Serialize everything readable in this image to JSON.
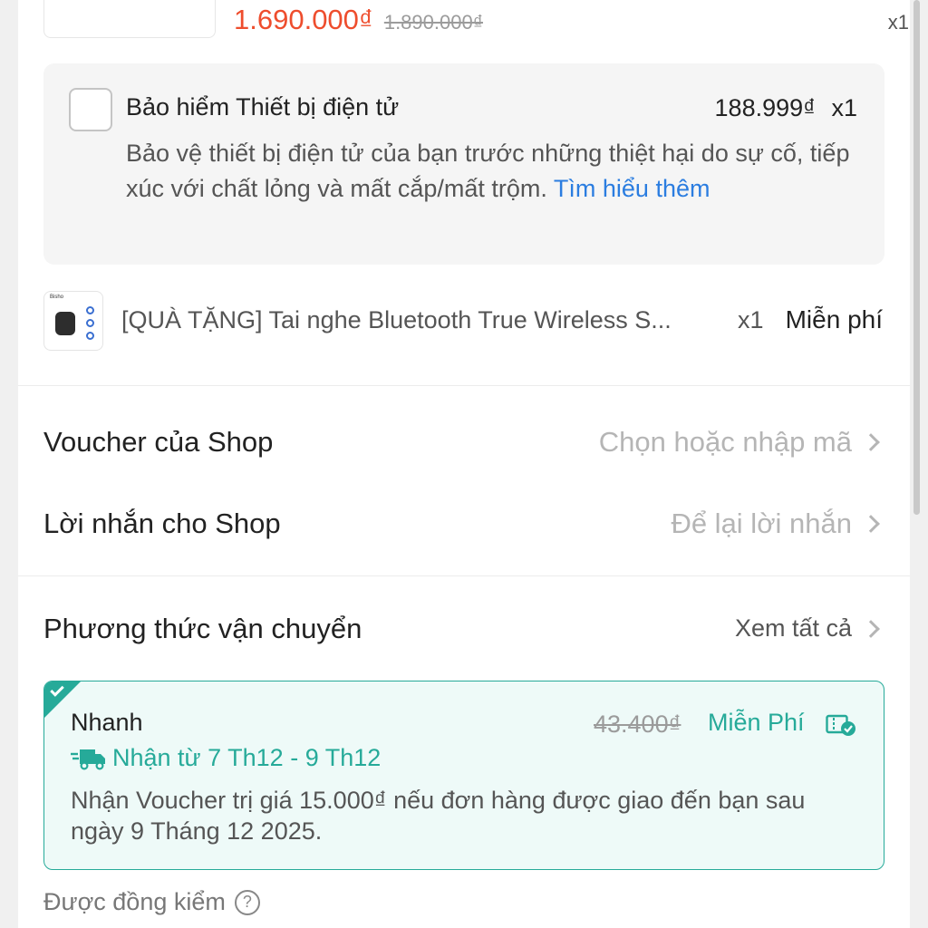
{
  "product": {
    "price_now": "1.690.000₫",
    "price_old": "1.890.000₫",
    "qty": "x1"
  },
  "insurance": {
    "title": "Bảo hiểm Thiết bị điện tử",
    "price": "188.999₫",
    "qty": "x1",
    "description": "Bảo vệ thiết bị điện tử của bạn trước những thiệt hại do sự cố, tiếp xúc với chất lỏng và mất cắp/mất trộm. ",
    "link": "Tìm hiểu thêm",
    "checked": false
  },
  "gift": {
    "name": "[QUÀ TẶNG] Tai nghe Bluetooth True Wireless S...",
    "qty": "x1",
    "price": "Miễn phí",
    "thumb_text": "Bisho"
  },
  "voucher_row": {
    "label": "Voucher của Shop",
    "value": "Chọn hoặc nhập mã"
  },
  "message_row": {
    "label": "Lời nhắn cho Shop",
    "value": "Để lại lời nhắn"
  },
  "shipping": {
    "title": "Phương thức vận chuyển",
    "see_all": "Xem tất cả",
    "option": {
      "name": "Nhanh",
      "old_fee": "43.400₫",
      "fee": "Miễn Phí",
      "eta": "Nhận từ 7 Th12 - 9 Th12",
      "note": "Nhận Voucher trị giá 15.000₫ nếu đơn hàng được giao đến bạn sau ngày 9 Tháng 12 2025."
    }
  },
  "cod": {
    "label": "Được đồng kiểm"
  },
  "colors": {
    "accent_orange": "#ee4d2d",
    "accent_teal": "#26aa99",
    "link_blue": "#2b7de0"
  }
}
